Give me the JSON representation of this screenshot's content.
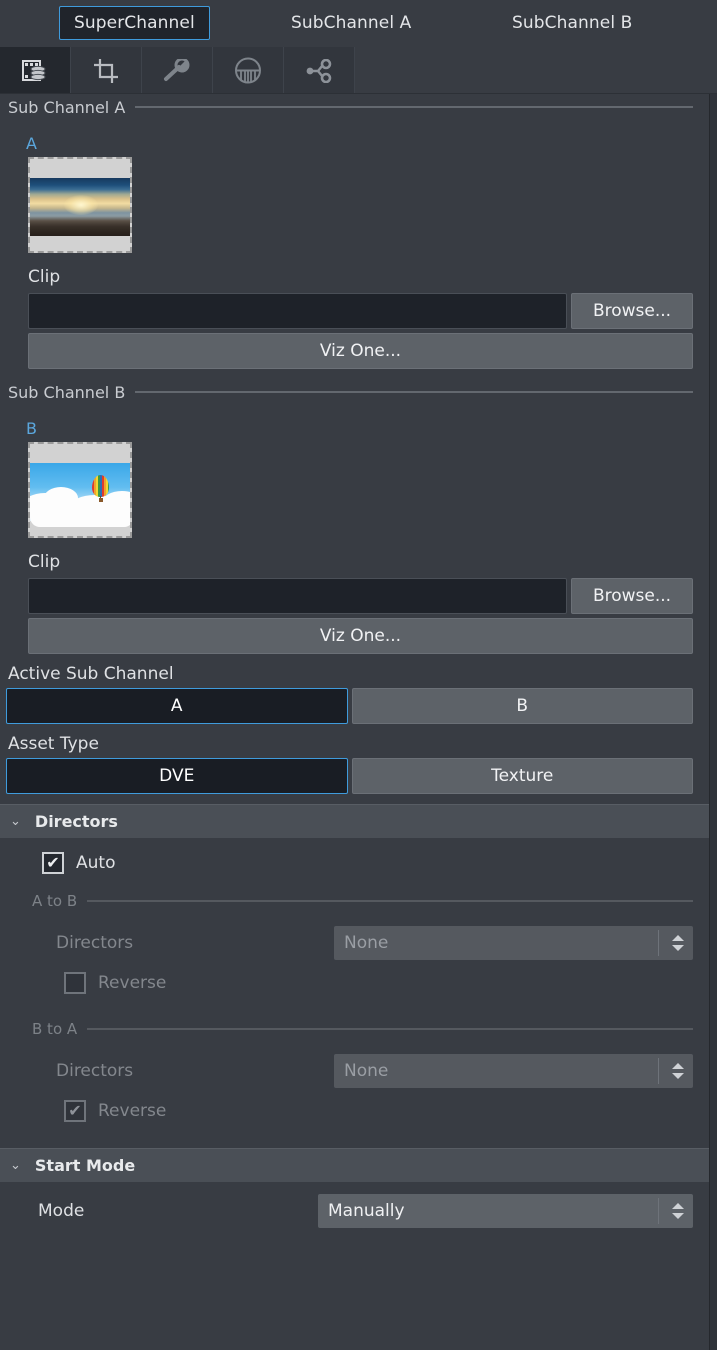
{
  "channel_tabs": [
    {
      "label": "SuperChannel",
      "active": true
    },
    {
      "label": "SubChannel A",
      "active": false
    },
    {
      "label": "SubChannel B",
      "active": false
    }
  ],
  "icon_tabs": [
    {
      "name": "media-icon",
      "active": true
    },
    {
      "name": "crop-icon",
      "active": false
    },
    {
      "name": "key-icon",
      "active": false
    },
    {
      "name": "basket-icon",
      "active": false
    },
    {
      "name": "transition-icon",
      "active": false
    }
  ],
  "sub_channel_a": {
    "group_label": "Sub Channel A",
    "letter": "A",
    "thumbnail_alt": "sunset-beach-thumbnail",
    "clip_label": "Clip",
    "clip_value": "",
    "clip_placeholder": "",
    "browse_label": "Browse...",
    "vizone_label": "Viz One..."
  },
  "sub_channel_b": {
    "group_label": "Sub Channel B",
    "letter": "B",
    "thumbnail_alt": "hot-air-balloon-thumbnail",
    "clip_label": "Clip",
    "clip_value": "",
    "clip_placeholder": "",
    "browse_label": "Browse...",
    "vizone_label": "Viz One..."
  },
  "active_sub_channel": {
    "label": "Active Sub Channel",
    "options": [
      "A",
      "B"
    ],
    "selected": "A"
  },
  "asset_type": {
    "label": "Asset Type",
    "options": [
      "DVE",
      "Texture"
    ],
    "selected": "DVE"
  },
  "directors": {
    "section_title": "Directors",
    "expanded": true,
    "chevron": "⌄",
    "auto": {
      "label": "Auto",
      "checked": true,
      "check_glyph": "✔"
    },
    "a_to_b": {
      "group_label": "A to B",
      "directors_label": "Directors",
      "directors_value": "None",
      "reverse_label": "Reverse",
      "reverse_checked": false,
      "check_glyph": ""
    },
    "b_to_a": {
      "group_label": "B to A",
      "directors_label": "Directors",
      "directors_value": "None",
      "reverse_label": "Reverse",
      "reverse_checked": true,
      "check_glyph": "✔"
    }
  },
  "start_mode": {
    "section_title": "Start Mode",
    "expanded": true,
    "chevron": "⌄",
    "mode_label": "Mode",
    "mode_value": "Manually"
  },
  "colors": {
    "background": "#383c43",
    "accent_blue": "#3f9bdc",
    "letter_blue": "#5ba7dd",
    "button_gray": "#5d6268",
    "section_header": "#4a4f56",
    "input_dark": "#1e2229"
  }
}
